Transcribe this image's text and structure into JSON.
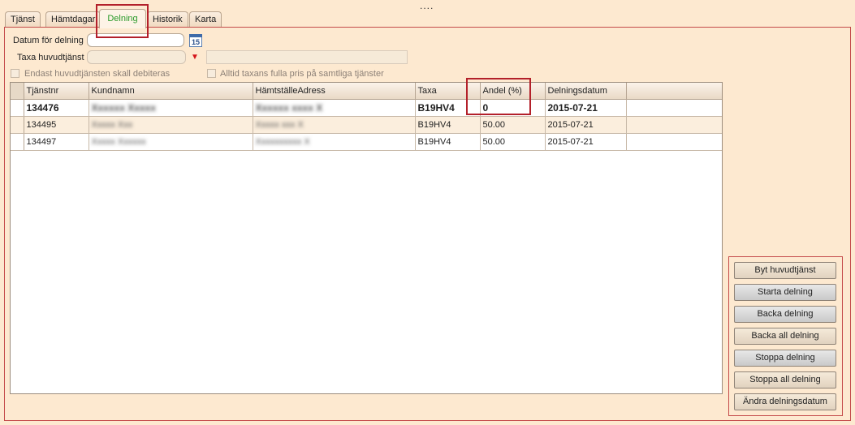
{
  "top_dots": "....",
  "tabs": [
    {
      "label": "Tjänst"
    },
    {
      "label": "Hämtdagar"
    },
    {
      "label": "Delning"
    },
    {
      "label": "Historik"
    },
    {
      "label": "Karta"
    }
  ],
  "form": {
    "datum_label": "Datum för delning",
    "datum_value": "",
    "calendar_day": "15",
    "taxa_label": "Taxa huvudtjänst",
    "taxa_value": "",
    "taxa_desc_value": "",
    "chk1_label": "Endast huvudtjänsten skall debiteras",
    "chk2_label": "Alltid taxans fulla pris på samtliga tjänster"
  },
  "grid": {
    "headers": [
      "Tjänstnr",
      "Kundnamn",
      "HämtställeAdress",
      "Taxa",
      "Andel (%)",
      "Delningsdatum"
    ],
    "rows": [
      [
        "134476",
        "Xxxxxx Xxxxx",
        "Xxxxxx xxxx X",
        "B19HV4",
        "0",
        "2015-07-21"
      ],
      [
        "134495",
        "Xxxxx Xxx",
        "Xxxxx xxx X",
        "B19HV4",
        "50.00",
        "2015-07-21"
      ],
      [
        "134497",
        "Xxxxx Xxxxxx",
        "Xxxxxxxxxx X",
        "B19HV4",
        "50.00",
        "2015-07-21"
      ]
    ]
  },
  "buttons": {
    "byt": "Byt huvudtjänst",
    "starta": "Starta delning",
    "backa": "Backa delning",
    "backa_all": "Backa all delning",
    "stoppa": "Stoppa delning",
    "stoppa_all": "Stoppa all delning",
    "andra": "Ändra delningsdatum"
  },
  "colors": {
    "background": "#fde9d0",
    "highlight": "#b3202a",
    "active_tab_text": "#2a9a2a"
  }
}
